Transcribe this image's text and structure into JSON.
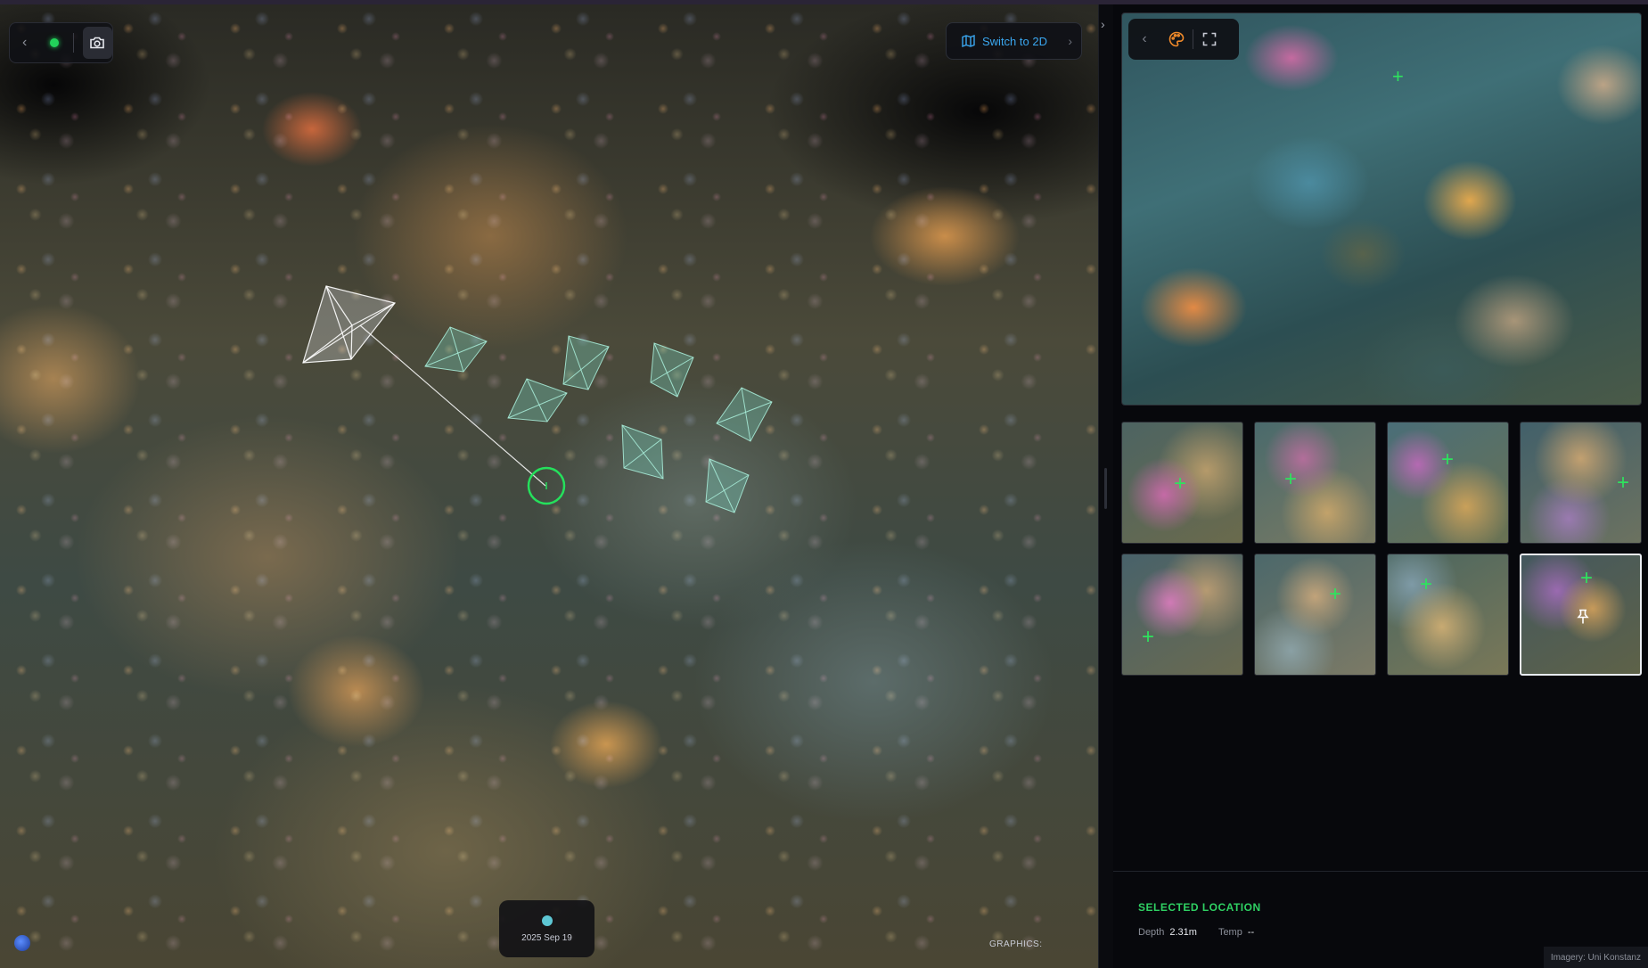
{
  "viewer": {
    "switch_label": "Switch to 2D",
    "timeline_date": "2025 Sep 19",
    "graphics_label": "GRAPHICS:",
    "graphics_value": ""
  },
  "panel": {
    "selected_title": "SELECTED LOCATION",
    "depth_label": "Depth",
    "depth_value": "2.31m",
    "temp_label": "Temp",
    "temp_value": "--",
    "imagery_credit": "Imagery: Uni Konstanz",
    "thumbnails_count": 8,
    "active_thumbnail": 8
  },
  "icons": {
    "back": "chevron-left-icon",
    "status": "status-dot",
    "camera": "camera-icon",
    "map": "map-icon",
    "palette": "palette-icon",
    "fullscreen": "fullscreen-icon",
    "pin": "pin-icon",
    "panel_toggle": "chevron-right-icon"
  },
  "colors": {
    "accent_green": "#2fd163",
    "link_blue": "#3aa7f0",
    "palette_orange": "#f08a2a",
    "graphics_value": "#f2c15a"
  }
}
